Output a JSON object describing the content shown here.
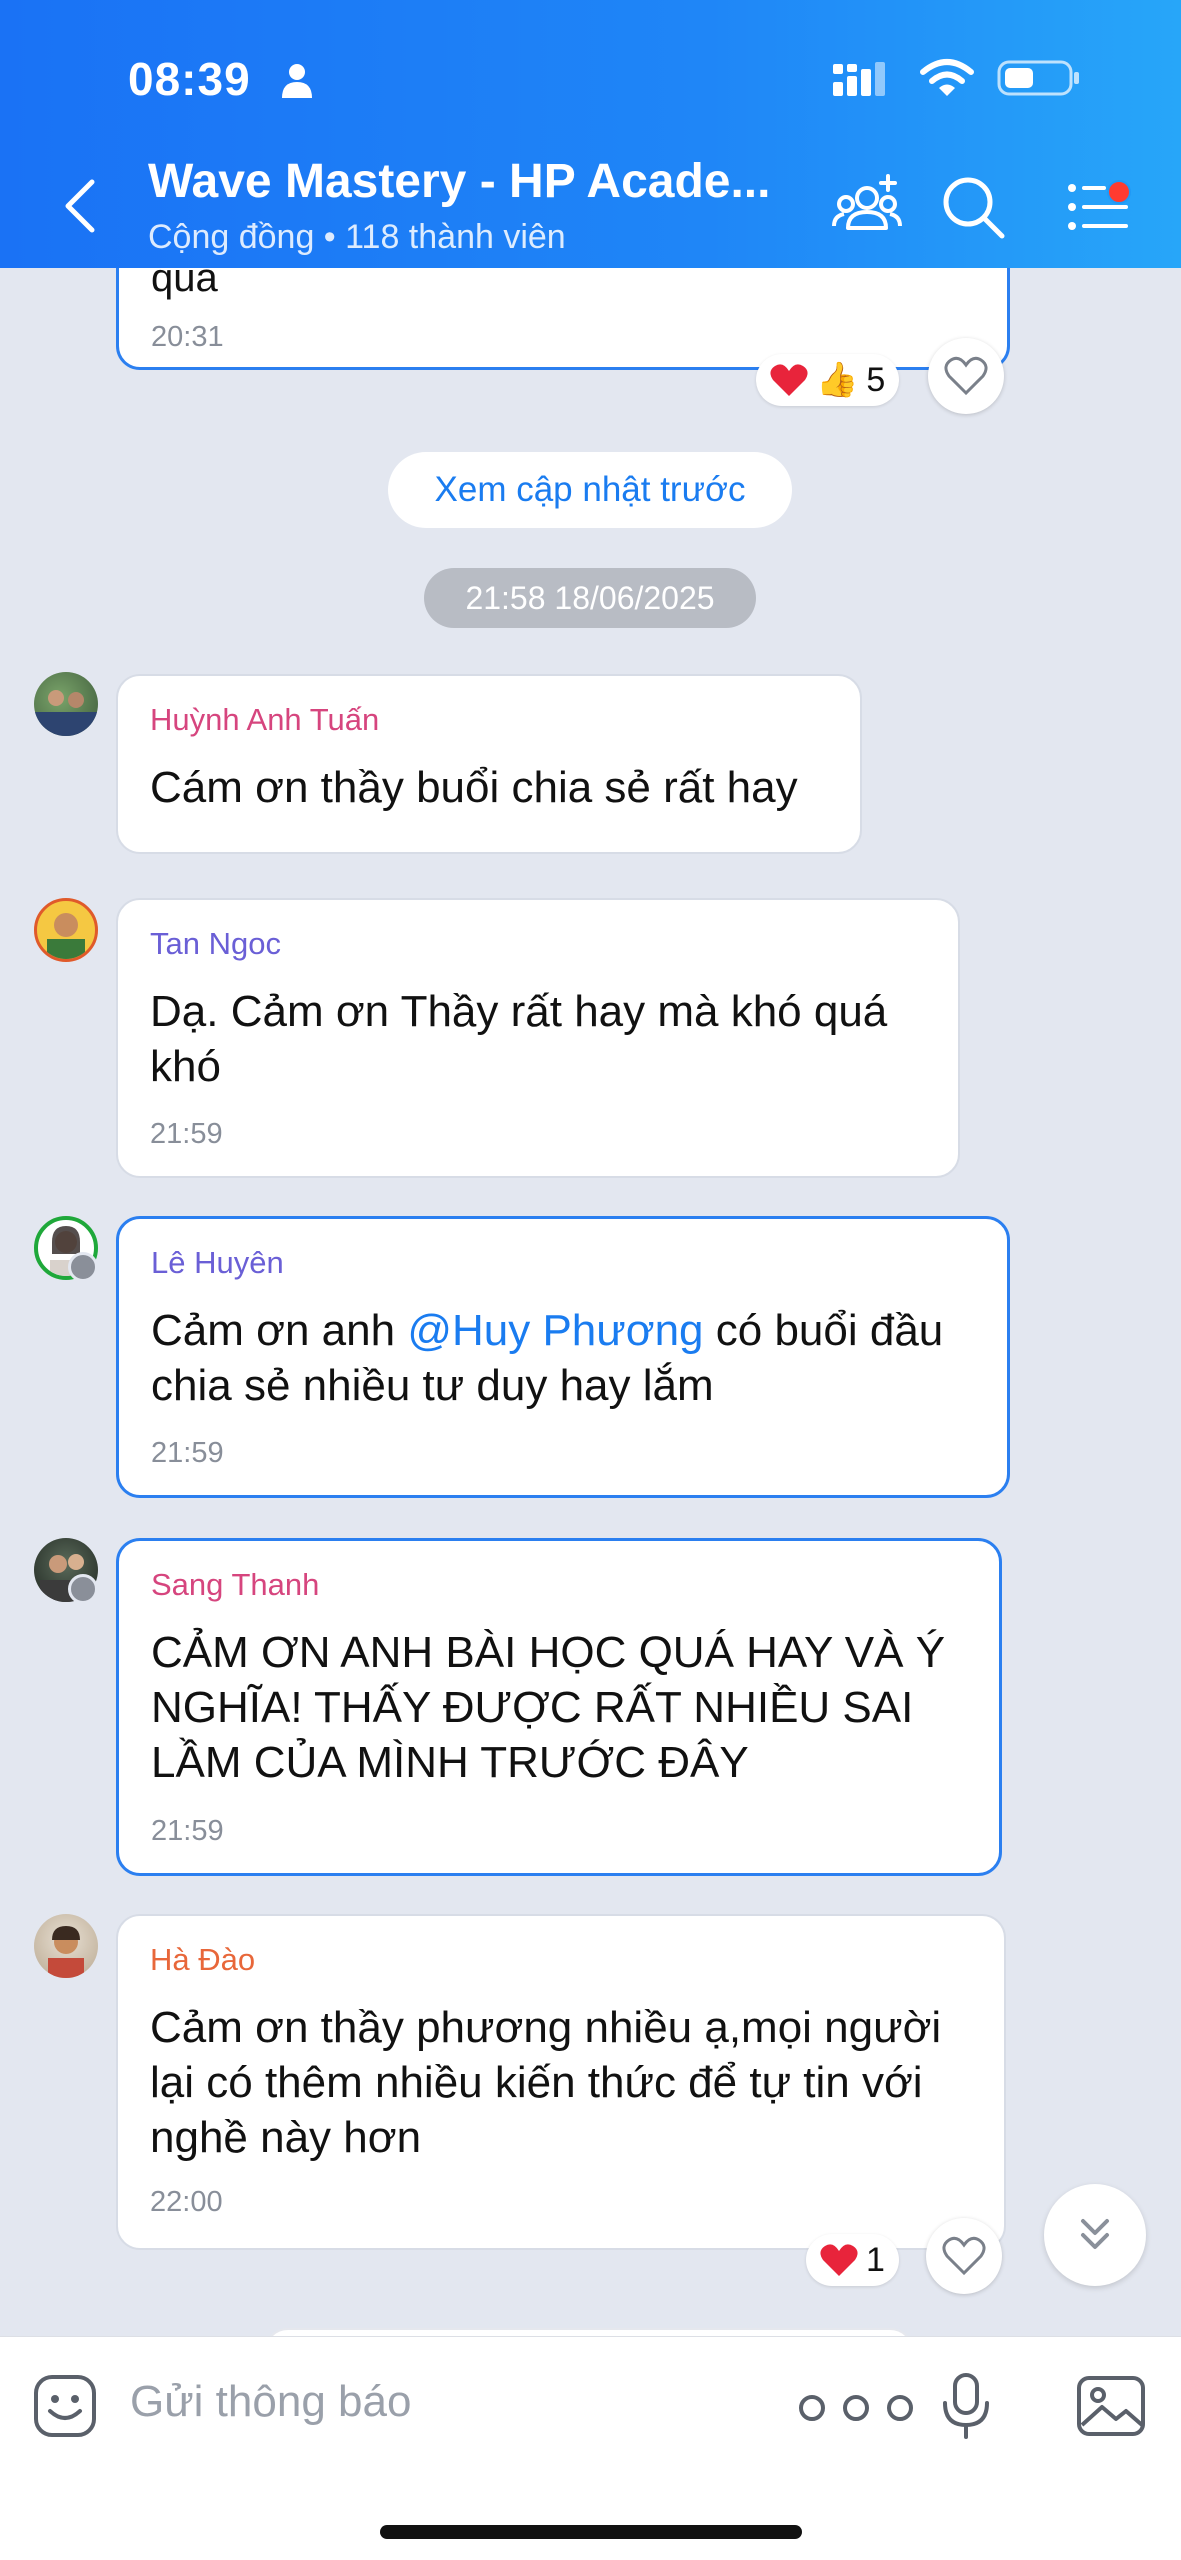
{
  "status_bar": {
    "time": "08:39"
  },
  "header": {
    "title": "Wave Mastery - HP Acade...",
    "subtitle": "Cộng đồng • 118 thành viên"
  },
  "chat": {
    "prev_message": {
      "text_fragment": "quá",
      "time": "20:31",
      "reaction_count": "5"
    },
    "load_previous_label": "Xem cập nhật trước",
    "date_separator": "21:58 18/06/2025",
    "messages": [
      {
        "sender": "Huỳnh Anh Tuấn",
        "sender_color": "#d6457e",
        "lines": [
          "Cám ơn thầy buổi chia sẻ rất hay"
        ],
        "time": ""
      },
      {
        "sender": "Tan Ngoc",
        "sender_color": "#6a5fd6",
        "lines": [
          "Dạ. Cảm ơn Thầy rất hay mà khó quá",
          "khó"
        ],
        "time": "21:59"
      },
      {
        "sender": "Lê Huyên",
        "sender_color": "#6a5fd6",
        "before_mention": "Cảm ơn anh ",
        "mention": "@Huy Phương",
        "after_mention": " có buổi đầu",
        "line2": "chia sẻ nhiều tư duy hay lắm",
        "time": "21:59"
      },
      {
        "sender": "Sang Thanh",
        "sender_color": "#d6457e",
        "lines": [
          "CẢM ƠN ANH BÀI HỌC QUÁ HAY VÀ Ý",
          "NGHĨA! THẤY ĐƯỢC RẤT NHIỀU SAI",
          "LẦM CỦA MÌNH TRƯỚC ĐÂY"
        ],
        "time": "21:59"
      },
      {
        "sender": "Hà Đào",
        "sender_color": "#e8673a",
        "lines": [
          "Cảm ơn thầy phương nhiều ạ,mọi người",
          "lại có thêm nhiều kiến thức để tự tin với",
          "nghề này hơn"
        ],
        "time": "22:00",
        "reaction_count": "1"
      }
    ]
  },
  "composer": {
    "placeholder": "Gửi thông báo"
  },
  "colors": {
    "accent": "#1a7cf0",
    "header_start": "#1a72f5",
    "header_end": "#27a6f9",
    "heart": "#e8243b"
  }
}
